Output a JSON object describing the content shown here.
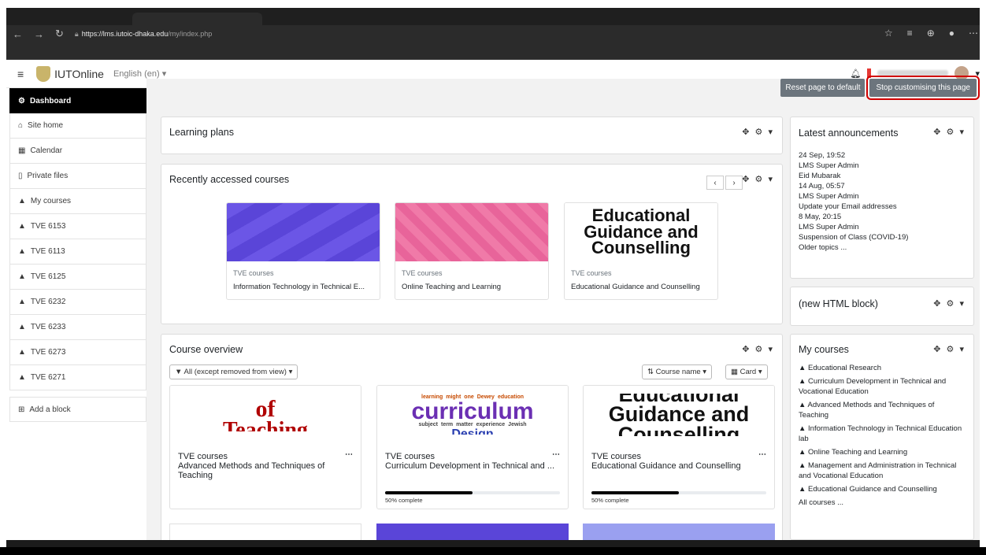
{
  "browser": {
    "url_prefix": "https://",
    "url_host": "lms.iutoic-dhaka.edu",
    "url_path": "/my/index.php"
  },
  "navbar": {
    "brand": "IUTOnline",
    "language": "English (en) ▾"
  },
  "buttons": {
    "reset": "Reset page to default",
    "stop": "Stop customising this page"
  },
  "sidebar": {
    "items": [
      {
        "icon": "dashboard-icon",
        "glyph": "⚙",
        "label": "Dashboard",
        "active": true
      },
      {
        "icon": "home-icon",
        "glyph": "⌂",
        "label": "Site home"
      },
      {
        "icon": "calendar-icon",
        "glyph": "▦",
        "label": "Calendar"
      },
      {
        "icon": "file-icon",
        "glyph": "▯",
        "label": "Private files"
      },
      {
        "icon": "graduation-cap-icon",
        "glyph": "▲",
        "label": "My courses"
      },
      {
        "icon": "graduation-cap-icon",
        "glyph": "▲",
        "label": "TVE 6153"
      },
      {
        "icon": "graduation-cap-icon",
        "glyph": "▲",
        "label": "TVE 6113"
      },
      {
        "icon": "graduation-cap-icon",
        "glyph": "▲",
        "label": "TVE 6125"
      },
      {
        "icon": "graduation-cap-icon",
        "glyph": "▲",
        "label": "TVE 6232"
      },
      {
        "icon": "graduation-cap-icon",
        "glyph": "▲",
        "label": "TVE 6233"
      },
      {
        "icon": "graduation-cap-icon",
        "glyph": "▲",
        "label": "TVE 6273"
      },
      {
        "icon": "graduation-cap-icon",
        "glyph": "▲",
        "label": "TVE 6271"
      }
    ],
    "add_block": "Add a block"
  },
  "blocks": {
    "learning_plans": "Learning plans",
    "recent": {
      "title": "Recently accessed courses",
      "courses": [
        {
          "category": "TVE courses",
          "name": "Information Technology in Technical E..."
        },
        {
          "category": "TVE courses",
          "name": "Online Teaching and Learning"
        },
        {
          "category": "TVE courses",
          "name": "Educational Guidance and Counselling"
        }
      ],
      "image_text": [
        "Educational",
        "Guidance and",
        "Counselling"
      ]
    },
    "overview": {
      "title": "Course overview",
      "filter": "All (except removed from view)",
      "sort": "Course name",
      "view": "Card",
      "courses": [
        {
          "category": "TVE courses",
          "name": "Advanced Methods and Techniques of Teaching",
          "progress": null
        },
        {
          "category": "TVE courses",
          "name": "Curriculum Development in Technical and ...",
          "progress": 50,
          "progress_label": "50% complete"
        },
        {
          "category": "TVE courses",
          "name": "Educational Guidance and Counselling",
          "progress": 50,
          "progress_label": "50% complete"
        }
      ],
      "img1": {
        "top": "of",
        "bottom": "Teaching"
      },
      "img2": {
        "main": "curriculum",
        "bottom": "Design",
        "words": [
          "learning",
          "might",
          "one",
          "Dewey",
          "education",
          "subject",
          "term",
          "matter",
          "experience",
          "Jewish"
        ]
      },
      "img3": [
        "Educational",
        "Guidance and",
        "Counselling"
      ]
    },
    "announcements": {
      "title": "Latest announcements",
      "items": [
        {
          "time": "24 Sep, 19:52",
          "author": "LMS Super Admin",
          "subject": "Eid Mubarak"
        },
        {
          "time": "14 Aug, 05:57",
          "author": "LMS Super Admin",
          "subject": "Update your Email addresses"
        },
        {
          "time": "8 May, 20:15",
          "author": "LMS Super Admin",
          "subject": "Suspension of Class (COVID-19)"
        }
      ],
      "older": "Older topics ..."
    },
    "html_block": "(new HTML block)",
    "my_courses": {
      "title": "My courses",
      "items": [
        "Educational Research",
        "Curriculum Development in Technical and Vocational Education",
        "Advanced Methods and Techniques of Teaching",
        "Information Technology in Technical Education lab",
        "Online Teaching and Learning",
        "Management and Administration in Technical and Vocational Education",
        "Educational Guidance and Counselling"
      ],
      "all": "All courses ..."
    }
  },
  "controls": "✥ ⚙ ▾",
  "colors": {
    "stop_outline": "#d10000",
    "button_bg": "#6c757d",
    "sidebar_active": "#000000"
  }
}
